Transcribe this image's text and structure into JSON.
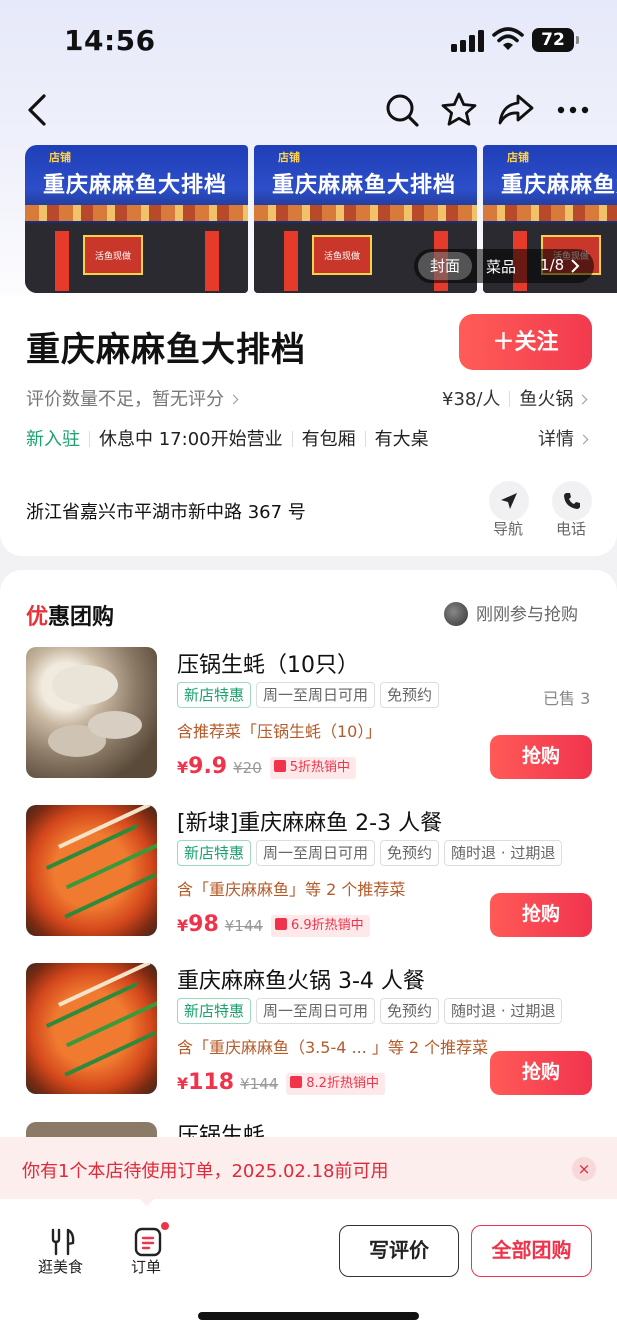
{
  "status_bar": {
    "time": "14:56",
    "battery": "72"
  },
  "gallery": {
    "photo_sign": "重庆麻麻鱼大排档",
    "photo_sign_top": "店铺",
    "photo_door": "活鱼现做",
    "tabs": [
      "封面",
      "菜品"
    ],
    "counter": "1/8"
  },
  "store": {
    "name": "重庆麻麻鱼大排档",
    "follow_label": "＋关注",
    "rating_text": "评价数量不足，暂无评分",
    "price_per_person": "¥38/人",
    "category": "鱼火锅",
    "new_badge": "新入驻",
    "status": "休息中",
    "hours": "17:00开始营业",
    "features": [
      "有包厢",
      "有大桌"
    ],
    "details_label": "详情",
    "address": "浙江省嘉兴市平湖市新中路 367 号",
    "nav_label": "导航",
    "phone_label": "电话"
  },
  "deals": {
    "title_first": "优",
    "title_rest": "惠团购",
    "joined_text": "刚刚参与抢购",
    "items": [
      {
        "title": "压锅生蚝（10只）",
        "tags": [
          "新店特惠",
          "周一至周日可用",
          "免预约"
        ],
        "sold": "已售 3",
        "includes": "含推荐菜「压锅生蚝（10）」",
        "price_symbol": "¥",
        "price": "9.9",
        "original": "¥20",
        "discount": "5折热销中",
        "buy_label": "抢购"
      },
      {
        "title": "[新埭]重庆麻麻鱼 2-3 人餐",
        "tags": [
          "新店特惠",
          "周一至周日可用",
          "免预约",
          "随时退 · 过期退"
        ],
        "includes": "含「重庆麻麻鱼」等 2 个推荐菜",
        "price_symbol": "¥",
        "price": "98",
        "original": "¥144",
        "discount": "6.9折热销中",
        "buy_label": "抢购"
      },
      {
        "title": "重庆麻麻鱼火锅 3-4 人餐",
        "tags": [
          "新店特惠",
          "周一至周日可用",
          "免预约",
          "随时退 · 过期退"
        ],
        "includes": "含「重庆麻麻鱼（3.5-4 ... 」等 2 个推荐菜",
        "price_symbol": "¥",
        "price": "118",
        "original": "¥144",
        "discount": "8.2折热销中",
        "buy_label": "抢购"
      }
    ],
    "partial_title": "压锅生蚝"
  },
  "toast": {
    "text": "你有1个本店待使用订单，2025.02.18前可用",
    "close": "×"
  },
  "bottom_bar": {
    "tabs": [
      "逛美食",
      "订单"
    ],
    "write_review": "写评价",
    "all_deals": "全部团购"
  },
  "colors": {
    "accent": "#f0334a",
    "new": "#1aa36d",
    "toast_bg": "#fdeeee"
  }
}
